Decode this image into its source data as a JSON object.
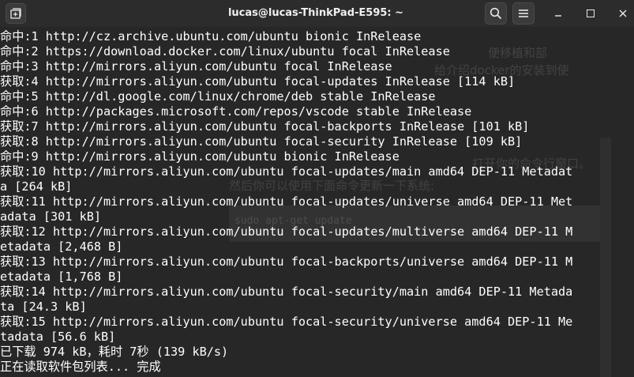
{
  "window": {
    "title": "lucas@lucas-ThinkPad-E595: ~",
    "icons": {
      "new_tab": "new-tab-icon",
      "search": "search-icon",
      "menu": "hamburger-menu-icon",
      "minimize": "minimize-icon",
      "maximize": "maximize-icon",
      "close": "close-icon"
    }
  },
  "terminal": {
    "lines": [
      "命中:1 http://cz.archive.ubuntu.com/ubuntu bionic InRelease",
      "命中:2 https://download.docker.com/linux/ubuntu focal InRelease",
      "命中:3 http://mirrors.aliyun.com/ubuntu focal InRelease",
      "获取:4 http://mirrors.aliyun.com/ubuntu focal-updates InRelease [114 kB]",
      "命中:5 http://dl.google.com/linux/chrome/deb stable InRelease",
      "命中:6 http://packages.microsoft.com/repos/vscode stable InRelease",
      "获取:7 http://mirrors.aliyun.com/ubuntu focal-backports InRelease [101 kB]",
      "获取:8 http://mirrors.aliyun.com/ubuntu focal-security InRelease [109 kB]",
      "命中:9 http://mirrors.aliyun.com/ubuntu bionic InRelease",
      "获取:10 http://mirrors.aliyun.com/ubuntu focal-updates/main amd64 DEP-11 Metadat",
      "a [264 kB]",
      "获取:11 http://mirrors.aliyun.com/ubuntu focal-updates/universe amd64 DEP-11 Met",
      "adata [301 kB]",
      "获取:12 http://mirrors.aliyun.com/ubuntu focal-updates/multiverse amd64 DEP-11 M",
      "etadata [2,468 B]",
      "获取:13 http://mirrors.aliyun.com/ubuntu focal-backports/universe amd64 DEP-11 M",
      "etadata [1,768 B]",
      "获取:14 http://mirrors.aliyun.com/ubuntu focal-security/main amd64 DEP-11 Metada",
      "ta [24.3 kB]",
      "获取:15 http://mirrors.aliyun.com/ubuntu focal-security/universe amd64 DEP-11 Me",
      "tadata [56.6 kB]",
      "已下载 974 kB，耗时 7秒 (139 kB/s)",
      "正在读取软件包列表... 完成"
    ]
  },
  "background_page": {
    "fragments": [
      "便移植和部",
      "给介绍docker的安装到使",
      "打开你的命令行窗口。",
      "然后你可以使用下面命令更新一下系统:",
      "sudo apt-get update"
    ]
  }
}
